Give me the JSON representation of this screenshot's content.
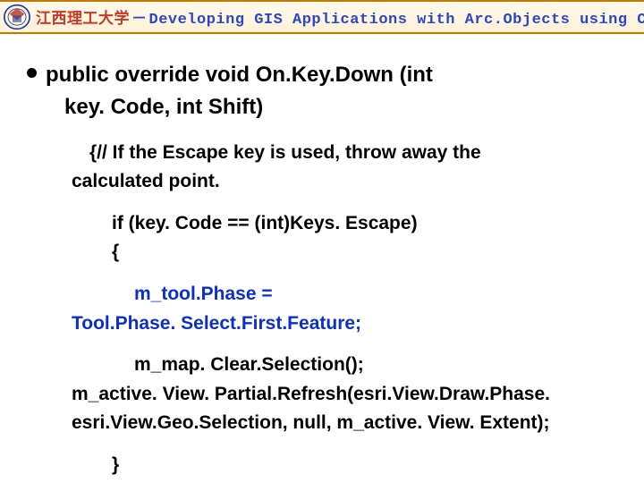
{
  "header": {
    "university": "江西理工大学",
    "separator": "－",
    "course": "Developing GIS Applications with Arc.Objects using C#. NE"
  },
  "code": {
    "sig_line1": "public override void On.Key.Down (int",
    "sig_line2": "key. Code, int Shift)",
    "comment1": " {// If the Escape key is used, throw away the",
    "comment2": "calculated point.",
    "if_line": "if (key. Code == (int)Keys. Escape)",
    "open_brace": "{",
    "assign1": "m_tool.Phase =",
    "assign2": "Tool.Phase. Select.First.Feature;",
    "clear": "m_map. Clear.Selection();",
    "refresh1": "m_active. View. Partial.Refresh(esri.View.Draw.Phase.",
    "refresh2": "esri.View.Geo.Selection, null, m_active. View. Extent);",
    "close_brace": "}"
  }
}
